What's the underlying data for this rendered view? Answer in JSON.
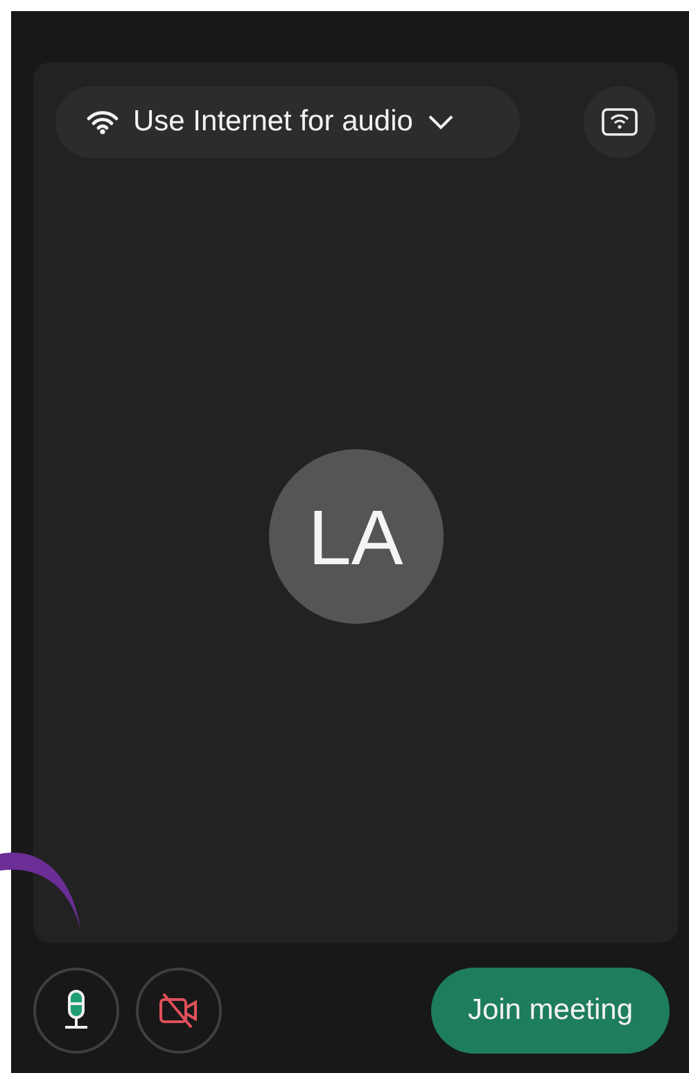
{
  "audio_selector": {
    "label": "Use Internet for audio"
  },
  "avatar": {
    "initials": "LA"
  },
  "controls": {
    "microphone": {
      "muted": false
    },
    "camera": {
      "on": false
    }
  },
  "join_button": {
    "label": "Join meeting"
  }
}
